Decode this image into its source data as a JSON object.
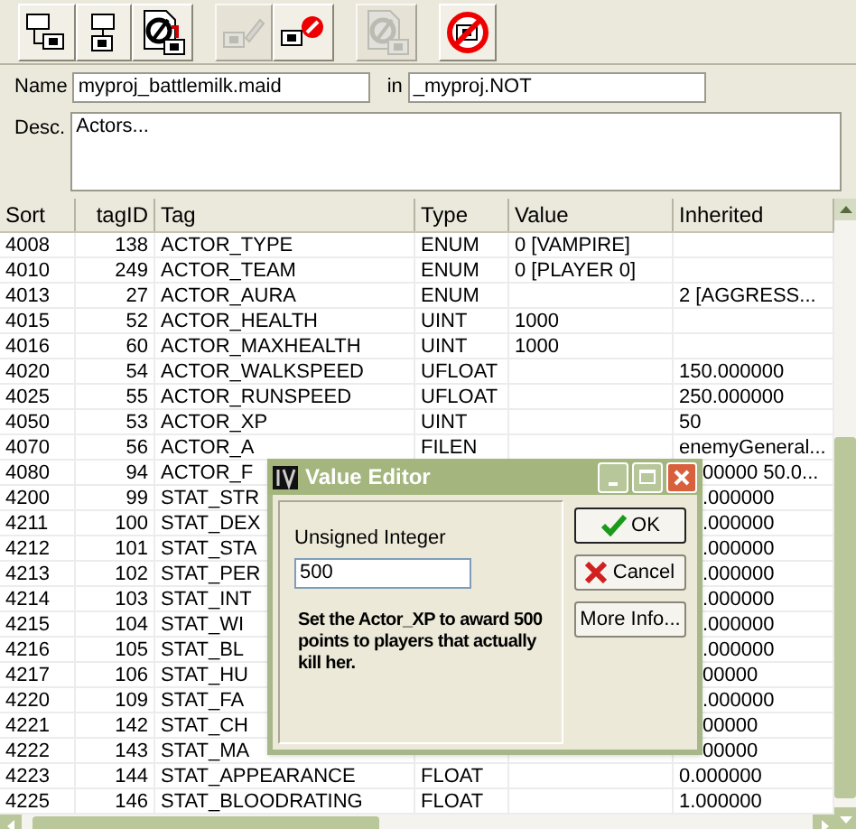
{
  "toolbar": [
    [
      {
        "kind": "tree",
        "disabled": false
      },
      {
        "kind": "tree-down",
        "disabled": false
      },
      {
        "kind": "document",
        "disabled": false
      }
    ],
    [
      {
        "kind": "pencil",
        "disabled": true
      },
      {
        "kind": "delete",
        "disabled": false
      }
    ],
    [
      {
        "kind": "document",
        "disabled": true
      }
    ],
    [
      {
        "kind": "no-entry",
        "disabled": false
      }
    ]
  ],
  "name_field": {
    "label": "Name",
    "value": "myproj_battlemilk.maid"
  },
  "in_field": {
    "label": "in",
    "value": "_myproj.NOT"
  },
  "desc_field": {
    "label": "Desc.",
    "value": "Actors..."
  },
  "table": {
    "columns": [
      "Sort",
      "tagID",
      "Tag",
      "Type",
      "Value",
      "Inherited"
    ],
    "rows": [
      {
        "sort": "4008",
        "tag_id": "138",
        "tag": "ACTOR_TYPE",
        "type": "ENUM",
        "value": "0  [VAMPIRE]"
      },
      {
        "sort": "4010",
        "tag_id": "249",
        "tag": "ACTOR_TEAM",
        "type": "ENUM",
        "value": "0  [PLAYER 0]"
      },
      {
        "sort": "4013",
        "tag_id": "27",
        "tag": "ACTOR_AURA",
        "type": "ENUM",
        "inherited": "2  [AGGRESS..."
      },
      {
        "sort": "4015",
        "tag_id": "52",
        "tag": "ACTOR_HEALTH",
        "type": "UINT",
        "value": "1000"
      },
      {
        "sort": "4016",
        "tag_id": "60",
        "tag": "ACTOR_MAXHEALTH",
        "type": "UINT",
        "value": "1000"
      },
      {
        "sort": "4020",
        "tag_id": "54",
        "tag": "ACTOR_WALKSPEED",
        "type": "UFLOAT",
        "inherited": "150.000000"
      },
      {
        "sort": "4025",
        "tag_id": "55",
        "tag": "ACTOR_RUNSPEED",
        "type": "UFLOAT",
        "inherited": "250.000000"
      },
      {
        "sort": "4050",
        "tag_id": "53",
        "tag": "ACTOR_XP",
        "type": "UINT",
        "inherited": "50"
      },
      {
        "sort": "4070",
        "tag_id": "56",
        "tag": "ACTOR_A",
        "type": "FILEN",
        "inherited": "enemyGeneral..."
      },
      {
        "sort": "4080",
        "tag_id": "94",
        "tag": "ACTOR_F",
        "inherited": "00000 50.0...",
        "partly_hidden": true
      },
      {
        "sort": "4200",
        "tag_id": "99",
        "tag": "STAT_STR",
        "inherited": ".000000",
        "partly_hidden": true
      },
      {
        "sort": "4211",
        "tag_id": "100",
        "tag": "STAT_DEX",
        "inherited": ".000000",
        "partly_hidden": true
      },
      {
        "sort": "4212",
        "tag_id": "101",
        "tag": "STAT_STA",
        "inherited": ".000000",
        "partly_hidden": true
      },
      {
        "sort": "4213",
        "tag_id": "102",
        "tag": "STAT_PER",
        "inherited": ".000000",
        "partly_hidden": true
      },
      {
        "sort": "4214",
        "tag_id": "103",
        "tag": "STAT_INT",
        "inherited": ".000000",
        "partly_hidden": true
      },
      {
        "sort": "4215",
        "tag_id": "104",
        "tag": "STAT_WI",
        "inherited": ".000000",
        "partly_hidden": true
      },
      {
        "sort": "4216",
        "tag_id": "105",
        "tag": "STAT_BL",
        "inherited": ".000000",
        "partly_hidden": true
      },
      {
        "sort": "4217",
        "tag_id": "106",
        "tag": "STAT_HU",
        "inherited": "00000",
        "partly_hidden": true
      },
      {
        "sort": "4220",
        "tag_id": "109",
        "tag": "STAT_FA",
        "inherited": ".000000",
        "partly_hidden": true
      },
      {
        "sort": "4221",
        "tag_id": "142",
        "tag": "STAT_CH",
        "inherited": "00000",
        "partly_hidden": true
      },
      {
        "sort": "4222",
        "tag_id": "143",
        "tag": "STAT_MA",
        "inherited": "00000",
        "partly_hidden": true
      },
      {
        "sort": "4223",
        "tag_id": "144",
        "tag": "STAT_APPEARANCE",
        "type": "FLOAT",
        "inherited": "0.000000"
      },
      {
        "sort": "4225",
        "tag_id": "146",
        "tag": "STAT_BLOODRATING",
        "type": "FLOAT",
        "inherited": "1.000000"
      }
    ]
  },
  "dialog": {
    "title": "Value Editor",
    "field_label": "Unsigned Integer",
    "field_value": "500",
    "note": "Set the Actor_XP to award 500 points to players that actually kill her.",
    "buttons": [
      {
        "kind": "ok",
        "label": "OK"
      },
      {
        "kind": "cancel",
        "label": "Cancel"
      },
      {
        "kind": "info",
        "label": "More Info..."
      }
    ]
  }
}
